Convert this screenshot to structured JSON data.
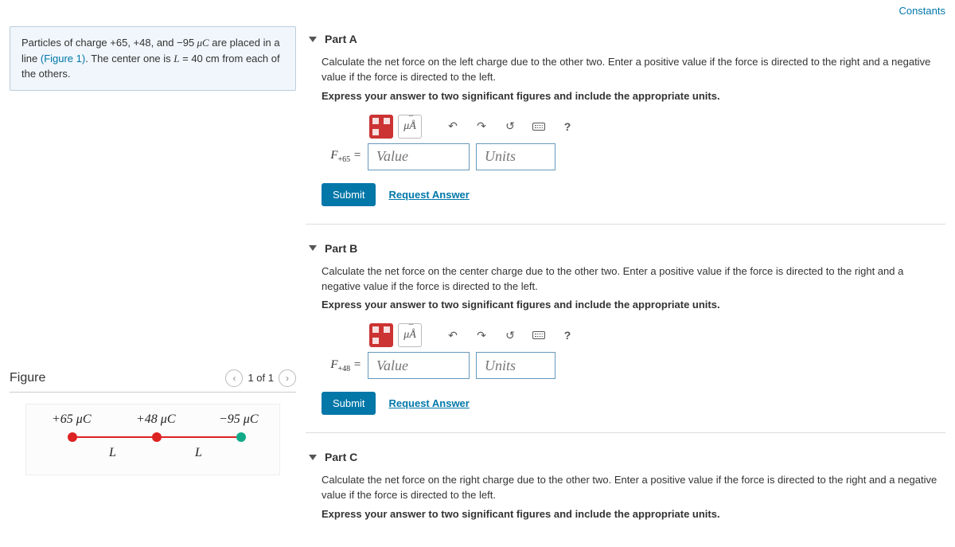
{
  "topLinks": {
    "constants": "Constants"
  },
  "problem": {
    "text_before": "Particles of charge +65, +48, and ",
    "charge_neg": "−95",
    "unit_muC": " μC",
    "text_after_unit": " are placed in a line ",
    "figref": "(Figure 1)",
    "text_mid": ". The center one is ",
    "var_L": "L",
    "eq_40": " = 40  cm",
    "text_end": " from each of the others."
  },
  "figure": {
    "title": "Figure",
    "count": "1 of 1",
    "charges": [
      {
        "label": "+65 μC",
        "color": "#d22"
      },
      {
        "label": "+48 μC",
        "color": "#d22"
      },
      {
        "label": "−95 μC",
        "color": "#1a8"
      }
    ],
    "dist": "L"
  },
  "parts": [
    {
      "title": "Part A",
      "prompt": "Calculate the net force on the left charge due to the other two. Enter a positive value if the force is directed to the right and a negative value if the force is directed to the left.",
      "instr": "Express your answer to two significant figures and include the appropriate units.",
      "label_sub": "+65",
      "value_ph": "Value",
      "units_ph": "Units",
      "submit": "Submit",
      "request": "Request Answer"
    },
    {
      "title": "Part B",
      "prompt": "Calculate the net force on the center charge due to the other two. Enter a positive value if the force is directed to the right and a negative value if the force is directed to the left.",
      "instr": "Express your answer to two significant figures and include the appropriate units.",
      "label_sub": "+48",
      "value_ph": "Value",
      "units_ph": "Units",
      "submit": "Submit",
      "request": "Request Answer"
    },
    {
      "title": "Part C",
      "prompt": "Calculate the net force on the right charge due to the other two. Enter a positive value if the force is directed to the right and a negative value if the force is directed to the left.",
      "instr": "Express your answer to two significant figures and include the appropriate units."
    }
  ],
  "toolbar": {
    "muA": "μÅ"
  }
}
